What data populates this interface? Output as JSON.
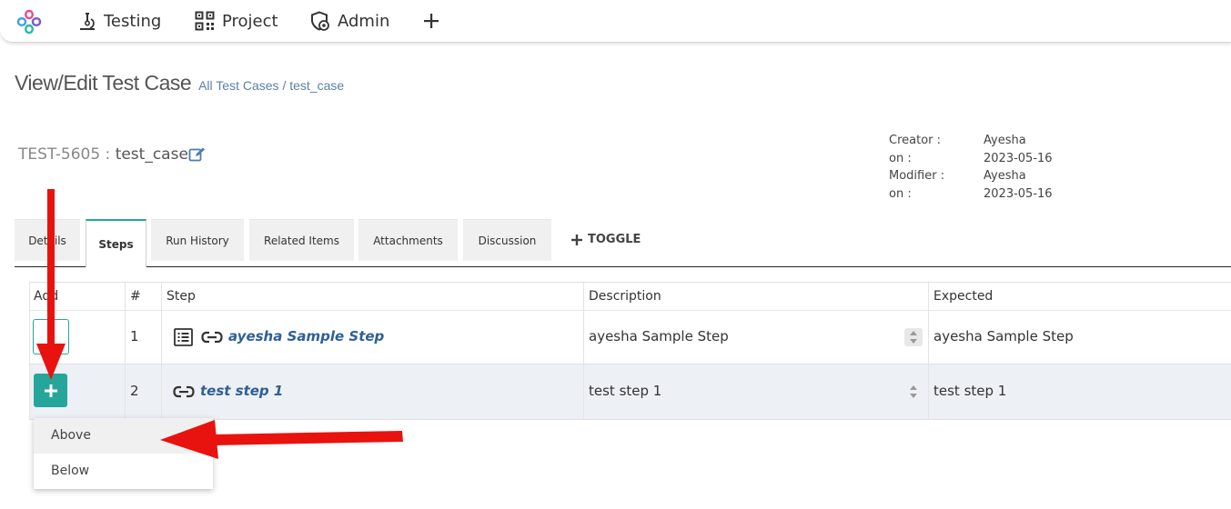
{
  "nav": {
    "items": [
      {
        "label": "Testing",
        "icon": "microscope-icon"
      },
      {
        "label": "Project",
        "icon": "qr-grid-icon"
      },
      {
        "label": "Admin",
        "icon": "shield-gear-icon"
      }
    ],
    "add_icon": "plus-icon"
  },
  "page": {
    "title": "View/Edit Test Case",
    "breadcrumb": {
      "all": "All Test Cases",
      "sep": "/",
      "current": "test_case"
    }
  },
  "testcase": {
    "id": "TEST-5605",
    "sep": " : ",
    "name": "test_case"
  },
  "meta": {
    "creator_label": "Creator :",
    "creator": "Ayesha",
    "on1_label": "on :",
    "on1": "2023-05-16",
    "modifier_label": "Modifier :",
    "modifier": "Ayesha",
    "on2_label": "on :",
    "on2": "2023-05-16"
  },
  "tabs": [
    "Details",
    "Steps",
    "Run History",
    "Related Items",
    "Attachments",
    "Discussion"
  ],
  "active_tab": "Steps",
  "toggle_label": "TOGGLE",
  "grid": {
    "headers": [
      "Add",
      "#",
      "Step",
      "Description",
      "Expected"
    ],
    "rows": [
      {
        "num": "1",
        "step": "ayesha Sample Step",
        "description": "ayesha Sample Step",
        "expected": "ayesha Sample Step"
      },
      {
        "num": "2",
        "step": "test step 1",
        "description": "test step 1",
        "expected": "test step 1"
      }
    ]
  },
  "add_menu": {
    "above": "Above",
    "below": "Below"
  },
  "colors": {
    "accent": "#26a69a",
    "link": "#2e5f96",
    "arrow": "#e8130f"
  }
}
